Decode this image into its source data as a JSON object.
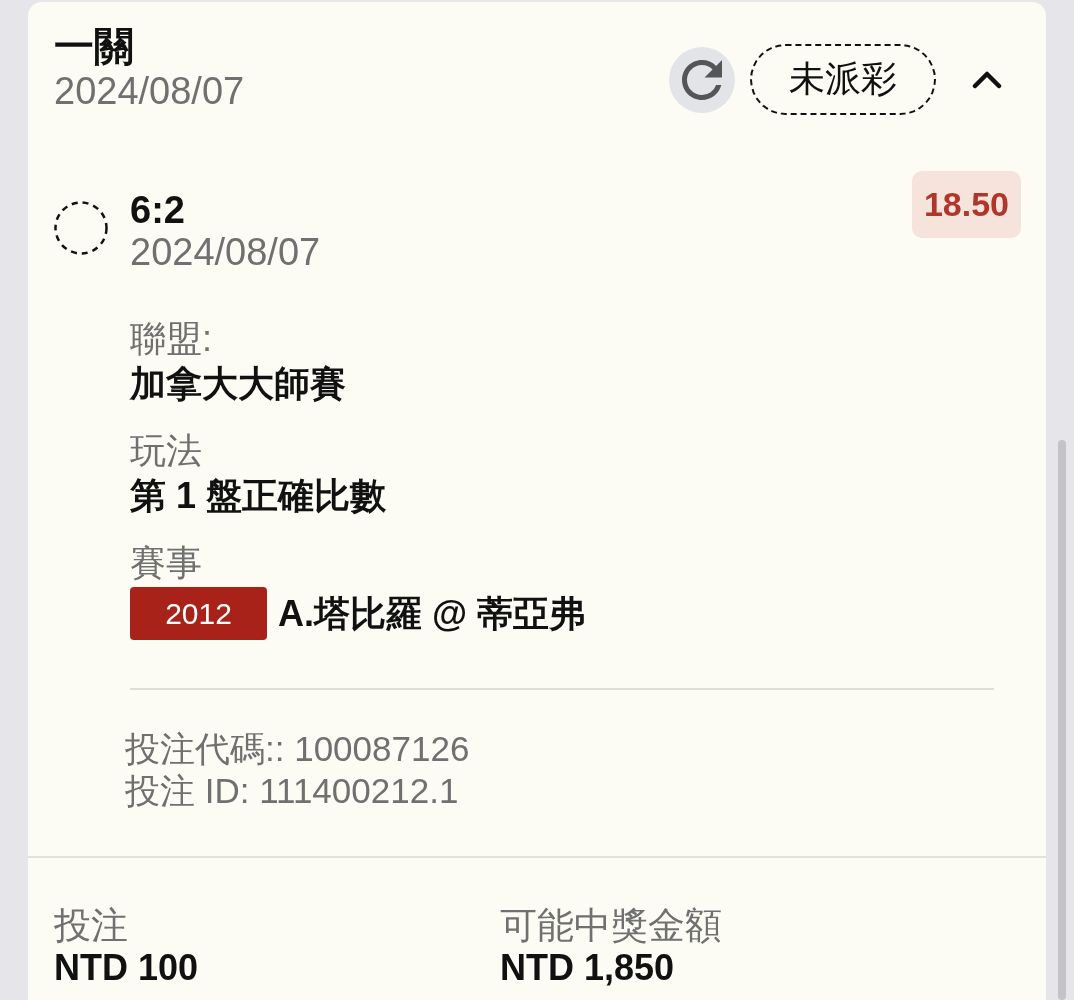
{
  "bet": {
    "title": "一關",
    "date": "2024/08/07",
    "status": "未派彩",
    "settled": false,
    "expanded": true
  },
  "selection": {
    "pick": "6:2",
    "date": "2024/08/07",
    "odds": "18.50",
    "settled": false,
    "fields": [
      {
        "kind": "text",
        "label": "聯盟:",
        "value": "加拿大大師賽"
      },
      {
        "kind": "text",
        "label": "玩法",
        "value": "第 1 盤正確比數"
      },
      {
        "kind": "event",
        "label": "賽事",
        "code": "2012",
        "value": "A.塔比羅 @ 蒂亞弗"
      }
    ],
    "bet_code": "投注代碼:: 100087126",
    "bet_id": "投注 ID: 111400212.1"
  },
  "summary": [
    {
      "label": "投注",
      "value": "NTD 100"
    },
    {
      "label": "可能中獎金額",
      "value": "NTD 1,850"
    }
  ]
}
